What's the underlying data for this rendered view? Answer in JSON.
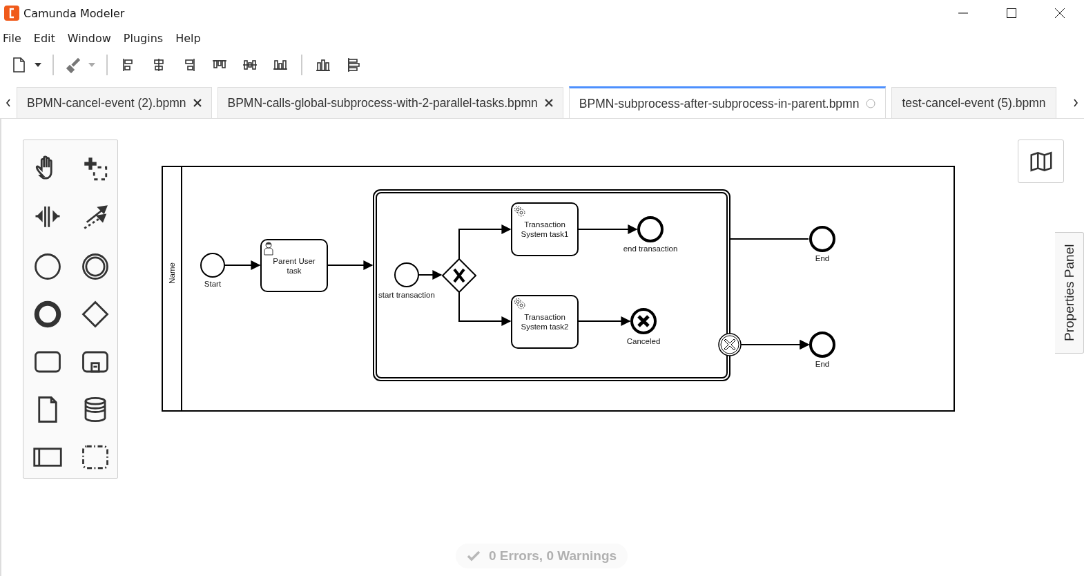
{
  "window": {
    "title": "Camunda Modeler"
  },
  "menu": [
    "File",
    "Edit",
    "Window",
    "Plugins",
    "Help"
  ],
  "tabs": [
    {
      "label": "BPMN-cancel-event (2).bpmn",
      "selected": false,
      "closable": true,
      "unsaved": false
    },
    {
      "label": "BPMN-calls-global-subprocess-with-2-parallel-tasks.bpmn",
      "selected": false,
      "closable": true,
      "unsaved": false
    },
    {
      "label": "BPMN-subprocess-after-subprocess-in-parent.bpmn",
      "selected": true,
      "closable": false,
      "unsaved": true
    },
    {
      "label": "test-cancel-event (5).bpmn",
      "selected": false
    }
  ],
  "diagram": {
    "pool": {
      "label": "Name"
    },
    "elements": [
      {
        "kind": "start-event",
        "label": "Start"
      },
      {
        "kind": "user-task",
        "label": "Parent User task"
      },
      {
        "kind": "transaction"
      },
      {
        "kind": "start-event",
        "label": "start transaction"
      },
      {
        "kind": "exclusive-gateway"
      },
      {
        "kind": "service-task",
        "label": "Transaction System task1"
      },
      {
        "kind": "service-task",
        "label": "Transaction System task2"
      },
      {
        "kind": "end-event",
        "label": "end transaction"
      },
      {
        "kind": "cancel-end-event",
        "label": "Canceled"
      },
      {
        "kind": "cancel-boundary-event"
      },
      {
        "kind": "end-event",
        "label": "End"
      },
      {
        "kind": "end-event",
        "label": "End"
      }
    ]
  },
  "properties_panel": {
    "label": "Properties Panel"
  },
  "status": {
    "text": "0 Errors, 0 Warnings"
  }
}
